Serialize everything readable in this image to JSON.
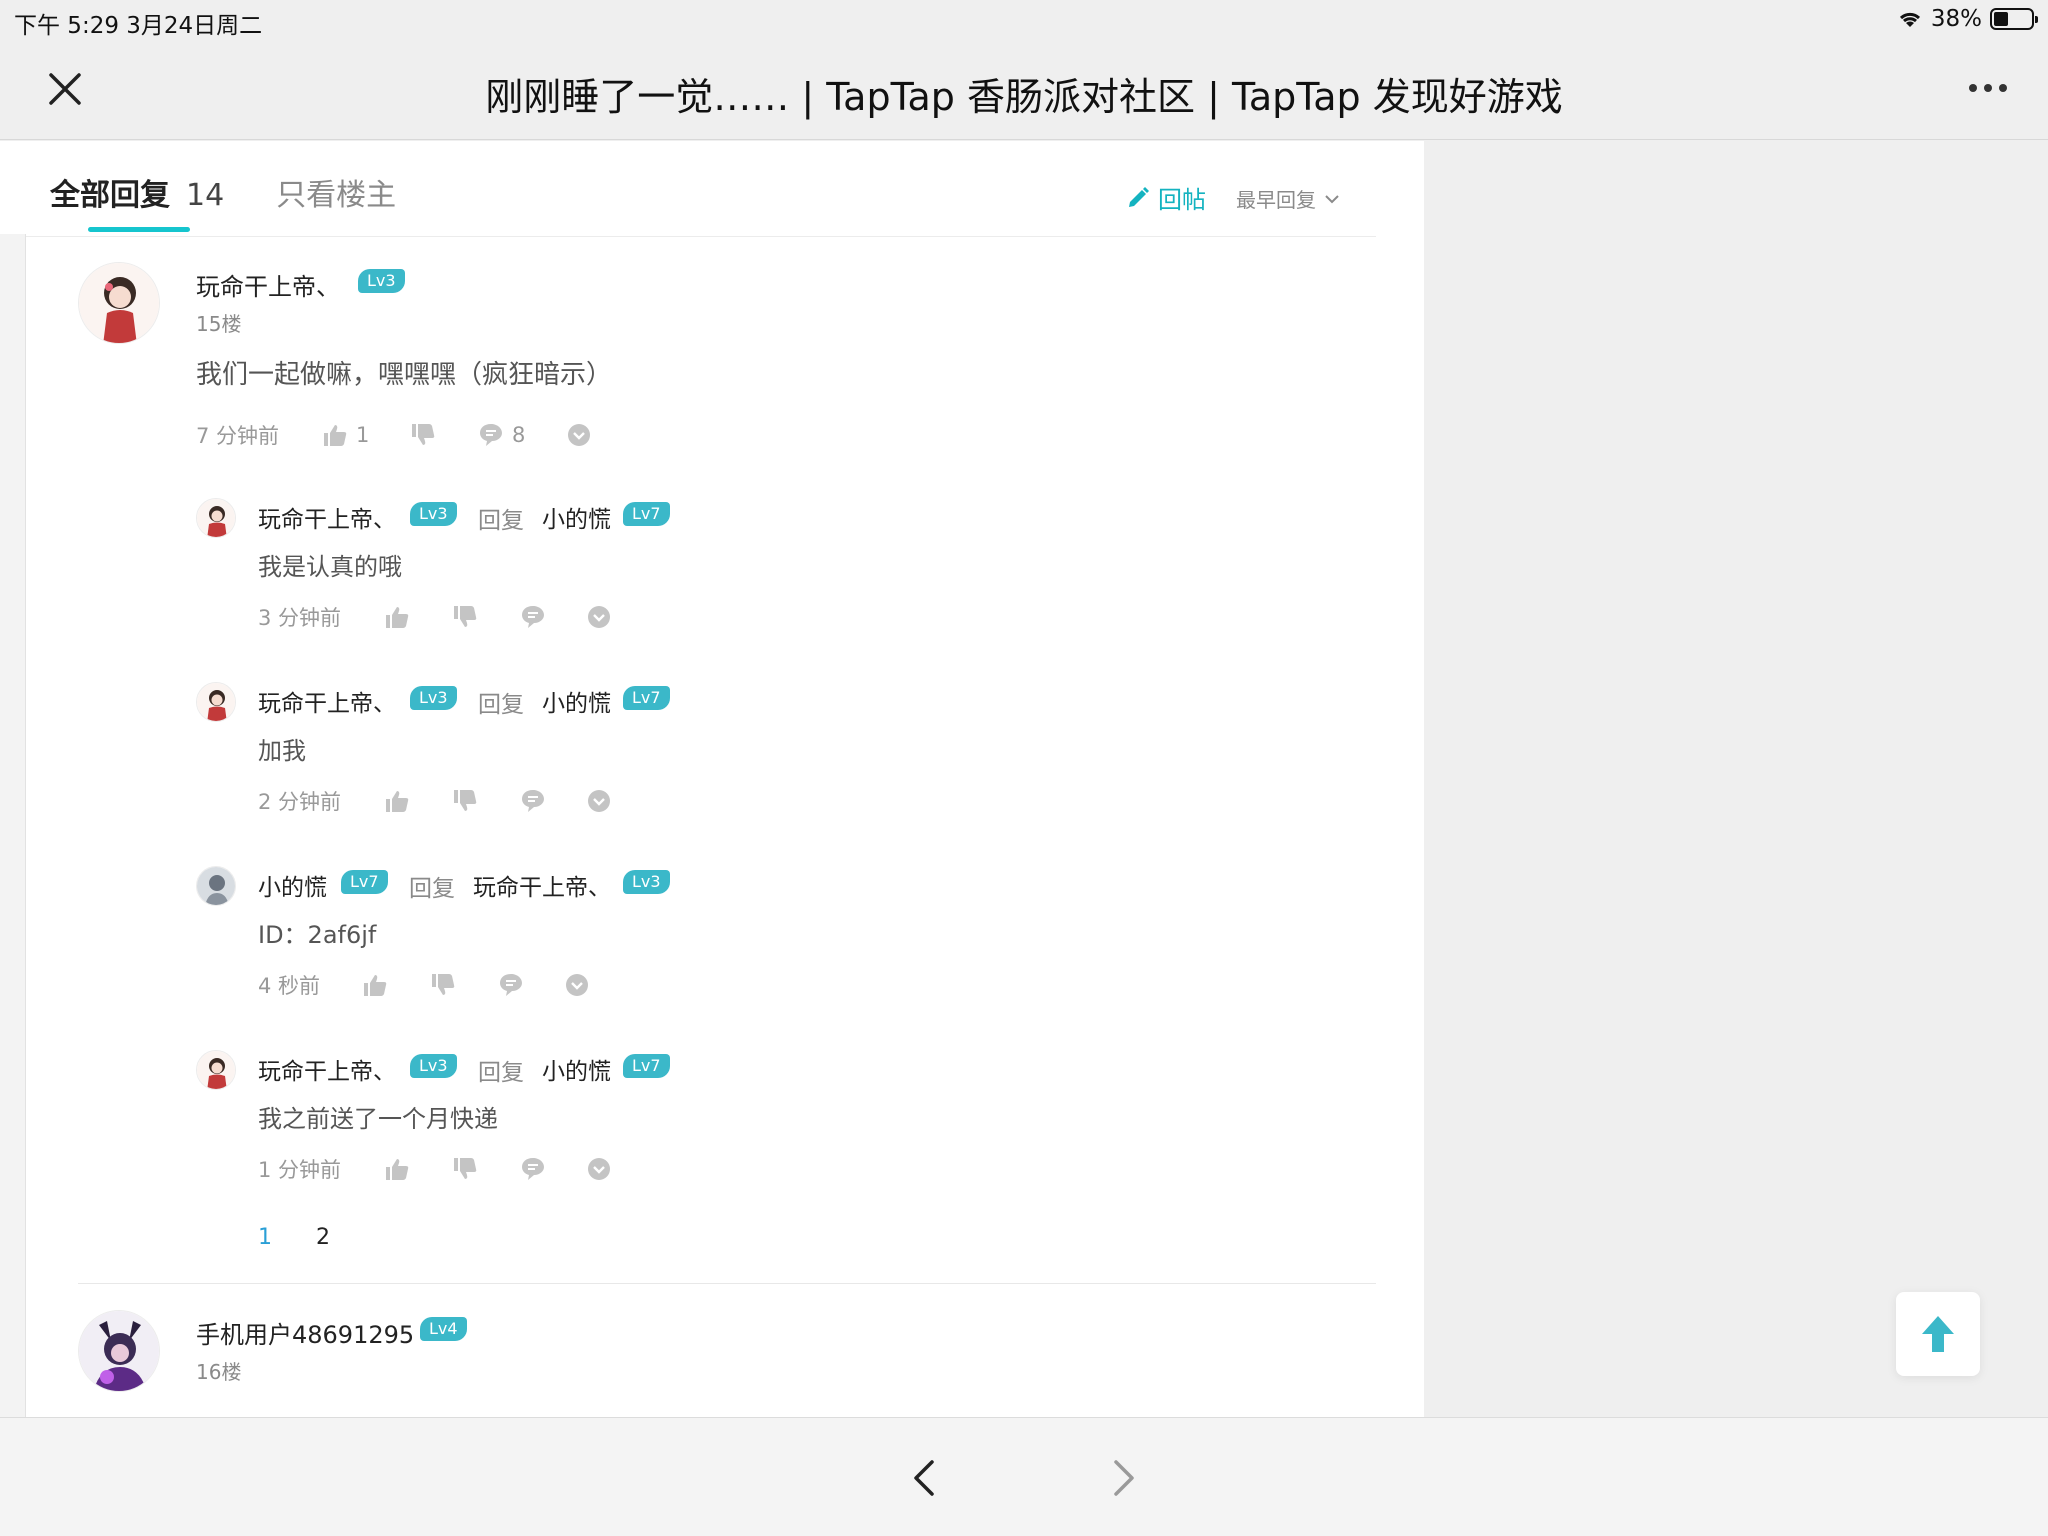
{
  "status": {
    "time_date": "下午 5:29   3月24日周二",
    "battery": "38%",
    "battery_level": 0.38
  },
  "header": {
    "title": "刚刚睡了一觉…… | TapTap 香肠派对社区 | TapTap 发现好游戏"
  },
  "tabs": {
    "all_label": "全部回复",
    "all_count": "14",
    "op_label": "只看楼主"
  },
  "actions": {
    "reply_label": "回帖",
    "sort_label": "最早回复"
  },
  "floor15": {
    "username": "玩命干上帝、",
    "level": "Lv3",
    "floor": "15楼",
    "content": "我们一起做嘛，嘿嘿嘿（疯狂暗示）",
    "time": "7 分钟前",
    "likes": "1",
    "comments": "8"
  },
  "subreplies": [
    {
      "author": "玩命干上帝、",
      "author_level": "Lv3",
      "reply_word": "回复",
      "target": "小的慌",
      "target_level": "Lv7",
      "content": "我是认真的哦",
      "time": "3 分钟前"
    },
    {
      "author": "玩命干上帝、",
      "author_level": "Lv3",
      "reply_word": "回复",
      "target": "小的慌",
      "target_level": "Lv7",
      "content": "加我",
      "time": "2 分钟前"
    },
    {
      "author": "小的慌",
      "author_level": "Lv7",
      "reply_word": "回复",
      "target": "玩命干上帝、",
      "target_level": "Lv3",
      "content": "ID：2af6jf",
      "time": "4 秒前"
    },
    {
      "author": "玩命干上帝、",
      "author_level": "Lv3",
      "reply_word": "回复",
      "target": "小的慌",
      "target_level": "Lv7",
      "content": "我之前送了一个月快递",
      "time": "1 分钟前"
    }
  ],
  "pagination": {
    "current": "1",
    "next": "2"
  },
  "floor16": {
    "username": "手机用户48691295",
    "level": "Lv4",
    "floor": "16楼"
  },
  "colors": {
    "accent": "#14b3c0",
    "level_badge": "#3bb8c9",
    "tab_underline": "#15c5ce",
    "pager_current": "#2a9fd6"
  },
  "icons": [
    "close-icon",
    "more-icon",
    "pencil-icon",
    "chevron-down-icon",
    "thumbs-up-icon",
    "thumbs-down-icon",
    "comment-icon",
    "expand-icon",
    "arrow-up-icon",
    "back-icon",
    "forward-icon",
    "wifi-icon",
    "battery-icon"
  ]
}
